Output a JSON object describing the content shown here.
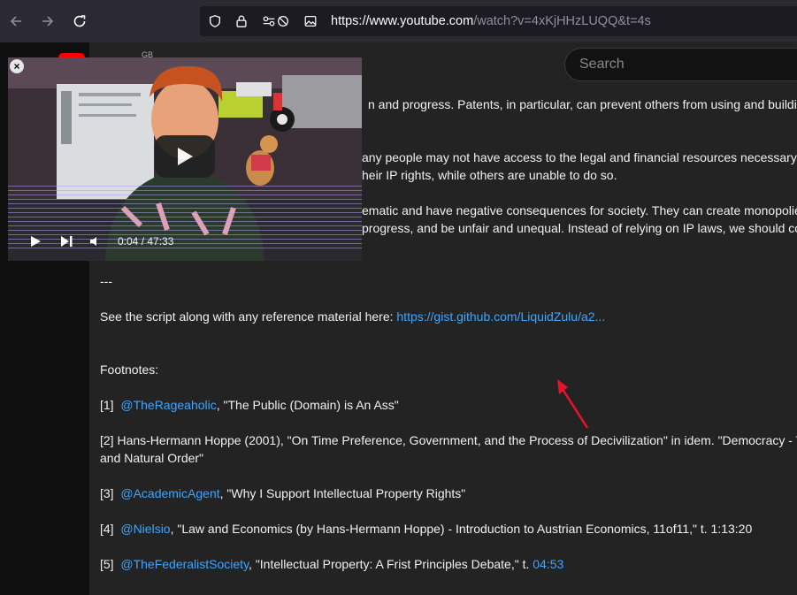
{
  "browser": {
    "url_host": "https://www.youtube.com",
    "url_path": "/watch?v=4xKjHHzLUQQ&t=4s"
  },
  "header": {
    "search_placeholder": "Search",
    "region": "GB"
  },
  "pip": {
    "time": "0:04 / 47:33"
  },
  "description": {
    "lines": [
      "n and progress. Patents, in particular, can prevent others from using and building",
      "any people may not have access to the legal and financial resources necessary t",
      "heir IP rights, while others are unable to do so.",
      "ematic and have negative consequences for society. They can create monopolie",
      "progress, and be unfair and unequal. Instead of relying on IP laws, we should co",
      "---"
    ],
    "script_prefix": "See the script along with any reference material here: ",
    "script_link": "https://gist.github.com/LiquidZulu/a2...",
    "footnotes_title": "Footnotes:",
    "fn1_num": "[1]",
    "fn1_handle": "@TheRageaholic",
    "fn1_text": ", \"The Public (Domain) is An Ass\"",
    "fn2_line1": "[2] Hans-Hermann Hoppe (2001), \"On Time Preference, Government, and the Process of Decivilization\" in idem. \"Democracy - Th",
    "fn2_line2": "and Natural Order\"",
    "fn3_num": "[3]",
    "fn3_handle": "@AcademicAgent",
    "fn3_text": ", \"Why I Support Intellectual Property Rights\"",
    "fn4_num": "[4]",
    "fn4_handle": "@Nielsio",
    "fn4_text": ", \"Law and Economics (by Hans-Hermann Hoppe) - Introduction to Austrian Economics, 11of11,\" t. 1:13:20",
    "fn5_num": "[5]",
    "fn5_handle": "@TheFederalistSociety",
    "fn5_text": ", \"Intellectual Property: A Frist Principles Debate,\" t. ",
    "fn5_time": "04:53"
  },
  "colors": {
    "link": "#3ea6ff",
    "annotation_arrow": "#e8132a"
  }
}
